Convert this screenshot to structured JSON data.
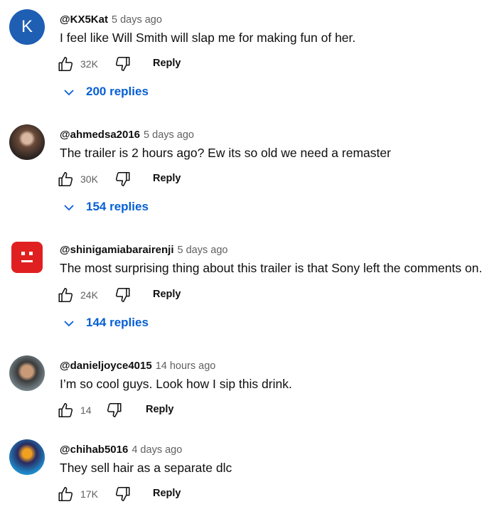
{
  "comments": [
    {
      "handle": "@KX5Kat",
      "time": "5 days ago",
      "text": "I feel like Will Smith will slap me for making fun of her.",
      "likes": "32K",
      "reply_label": "Reply",
      "replies": "200 replies",
      "avatar_letter": "K"
    },
    {
      "handle": "@ahmedsa2016",
      "time": "5 days ago",
      "text": "The trailer is 2 hours ago? Ew its so old we need a remaster",
      "likes": "30K",
      "reply_label": "Reply",
      "replies": "154 replies"
    },
    {
      "handle": "@shinigamiabarairenji",
      "time": "5 days ago",
      "text": "The most surprising thing about this trailer is that Sony left the comments on.",
      "likes": "24K",
      "reply_label": "Reply",
      "replies": "144 replies"
    },
    {
      "handle": "@danieljoyce4015",
      "time": "14 hours ago",
      "text": "I’m so cool guys. Look how I sip this drink.",
      "likes": "14",
      "reply_label": "Reply"
    },
    {
      "handle": "@chihab5016",
      "time": "4 days ago",
      "text": "They sell hair as a separate dlc",
      "likes": "17K",
      "reply_label": "Reply"
    }
  ],
  "colors": {
    "link": "#065fd4",
    "secondary": "#606060",
    "avatar_k": "#1e5fb4"
  }
}
